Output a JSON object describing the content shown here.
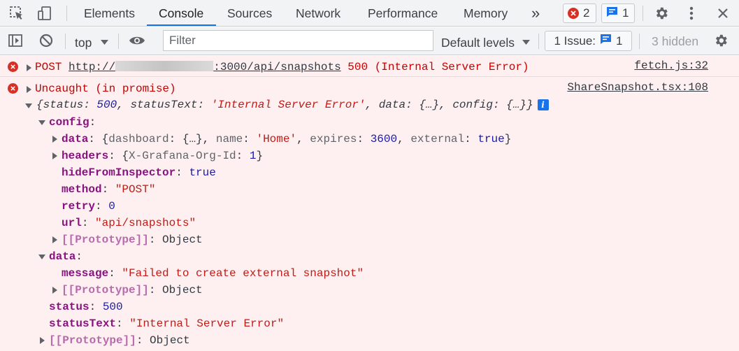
{
  "tabs": {
    "items": [
      "Elements",
      "Console",
      "Sources",
      "Network",
      "Performance",
      "Memory"
    ],
    "more": "»",
    "error_count": "2",
    "message_count": "1"
  },
  "toolbar": {
    "context": "top",
    "filter_placeholder": "Filter",
    "levels": "Default levels",
    "issues_label": "1 Issue:",
    "issues_count": "1",
    "hidden": "3 hidden"
  },
  "console": {
    "msg1": {
      "method": "POST",
      "url_start": "http://",
      "url_end": ":3000/api/snapshots",
      "status": "500 (Internal Server Error)",
      "source": "fetch.js:32"
    },
    "msg2": {
      "title": "Uncaught (in promise)",
      "source": "ShareSnapshot.tsx:108",
      "summary": {
        "status_key": "status",
        "status_val": "500",
        "statusText_key": "statusText",
        "statusText_val": "'Internal Server Error'",
        "data_key": "data",
        "config_key": "config",
        "collapsed": "{…}"
      },
      "config": {
        "key": "config",
        "data_key": "data",
        "data_preview_dashboard_key": "dashboard",
        "data_preview_dashboard_val": "{…}",
        "data_preview_name_key": "name",
        "data_preview_name_val": "'Home'",
        "data_preview_expires_key": "expires",
        "data_preview_expires_val": "3600",
        "data_preview_external_key": "external",
        "data_preview_external_val": "true",
        "headers_key": "headers",
        "headers_preview_key": "X-Grafana-Org-Id",
        "headers_preview_val": "1",
        "hide_key": "hideFromInspector",
        "hide_val": "true",
        "method_key": "method",
        "method_val": "\"POST\"",
        "retry_key": "retry",
        "retry_val": "0",
        "url_key": "url",
        "url_val": "\"api/snapshots\"",
        "proto_key": "[[Prototype]]",
        "proto_val": "Object"
      },
      "data": {
        "key": "data",
        "message_key": "message",
        "message_val": "\"Failed to create external snapshot\"",
        "proto_key": "[[Prototype]]",
        "proto_val": "Object"
      },
      "status_key": "status",
      "status_val": "500",
      "statusText_key": "statusText",
      "statusText_val": "\"Internal Server Error\"",
      "proto_key": "[[Prototype]]",
      "proto_val": "Object"
    }
  },
  "colors": {
    "error_red": "#d93025",
    "accent_blue": "#1a73e8",
    "console_error_bg": "#fef0f0"
  }
}
